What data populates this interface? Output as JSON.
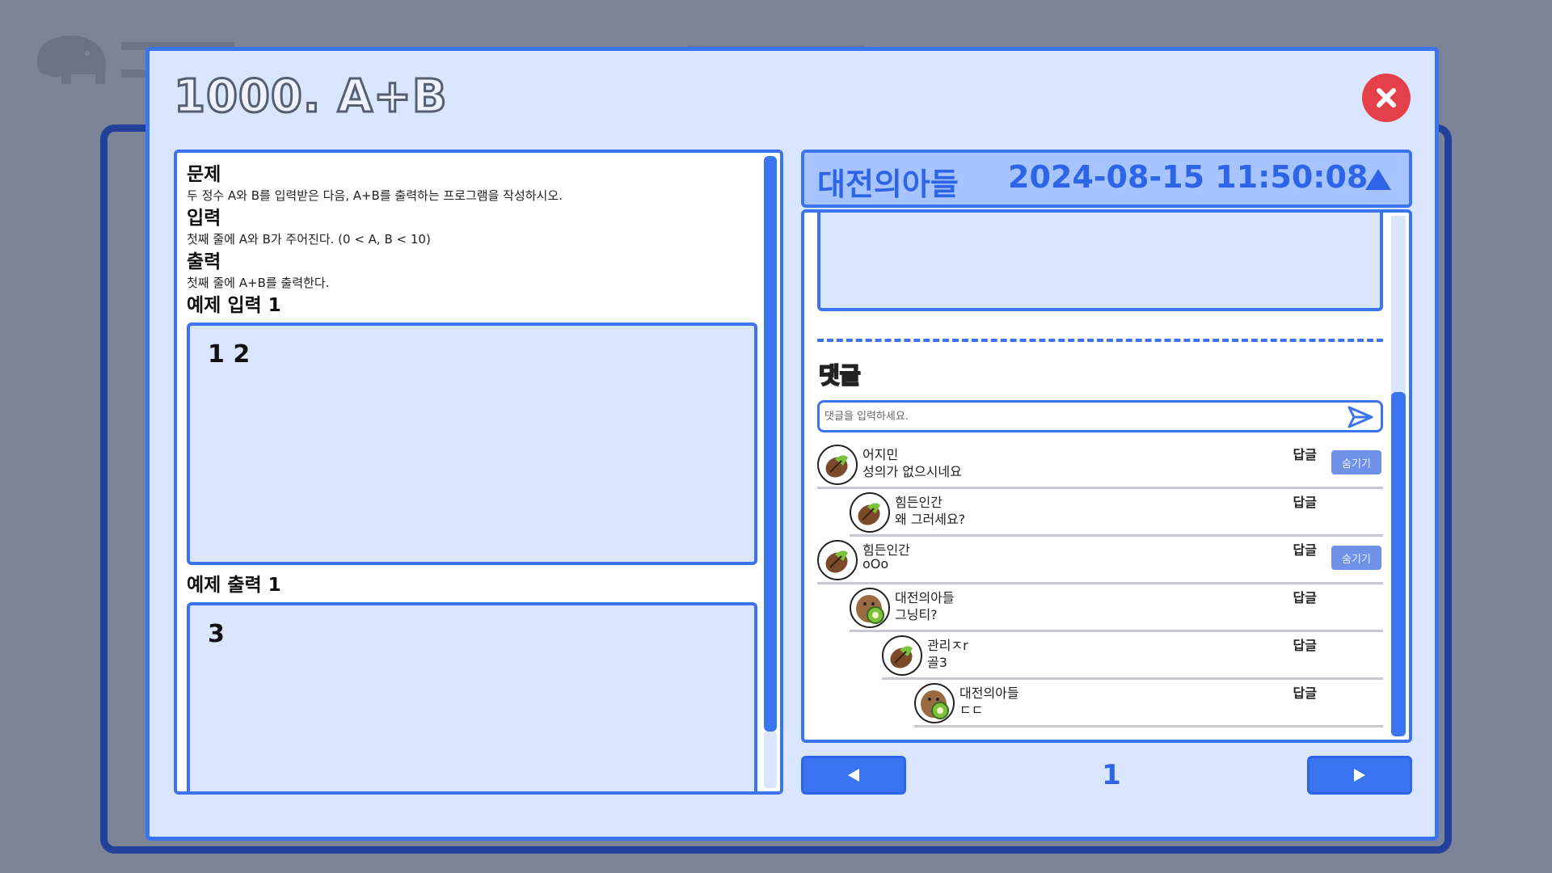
{
  "modal": {
    "title": "1000. A+B"
  },
  "problem": {
    "sections": [
      {
        "heading": "문제",
        "text": "두 정수 A와 B를 입력받은 다음, A+B를 출력하는 프로그램을 작성하시오."
      },
      {
        "heading": "입력",
        "text": "첫째 줄에 A와 B가 주어진다. (0 < A, B < 10)"
      },
      {
        "heading": "출력",
        "text": "첫째 줄에 A+B를 출력한다."
      }
    ],
    "sample_input_heading": "예제 입력 1",
    "sample_input": "1 2",
    "sample_output_heading": "예제 출력 1",
    "sample_output": "3"
  },
  "post": {
    "author": "대전의아들",
    "timestamp": "2024-08-15 11:50:08",
    "comments_heading": "댓글",
    "comment_placeholder": "댓글을 입력하세요."
  },
  "comments": [
    {
      "author": "어지민",
      "text": "성의가 없으시네요",
      "reply_label": "답글",
      "hide_label": "숨기기",
      "avatar": "bean-avatar"
    },
    {
      "author": "힘든인간",
      "text": "왜 그러세요?",
      "reply_label": "답글",
      "avatar": "bean-avatar"
    },
    {
      "author": "힘든인간",
      "text": "oOo",
      "reply_label": "답글",
      "hide_label": "숨기기",
      "avatar": "bean-avatar"
    },
    {
      "author": "대전의아들",
      "text": "그닝티?",
      "reply_label": "답글",
      "avatar": "kiwi-avatar"
    },
    {
      "author": "관리ㅈr",
      "text": "골3",
      "reply_label": "답글",
      "avatar": "bean-avatar"
    },
    {
      "author": "대전의아들",
      "text": "ㄷㄷ",
      "reply_label": "답글",
      "avatar": "kiwi-avatar"
    }
  ],
  "pagination": {
    "current_page": "1"
  },
  "colors": {
    "accent": "#3b74f0",
    "panel_bg": "#d9e6fd",
    "close": "#e5404a",
    "header_bg": "#a6c4ff"
  }
}
